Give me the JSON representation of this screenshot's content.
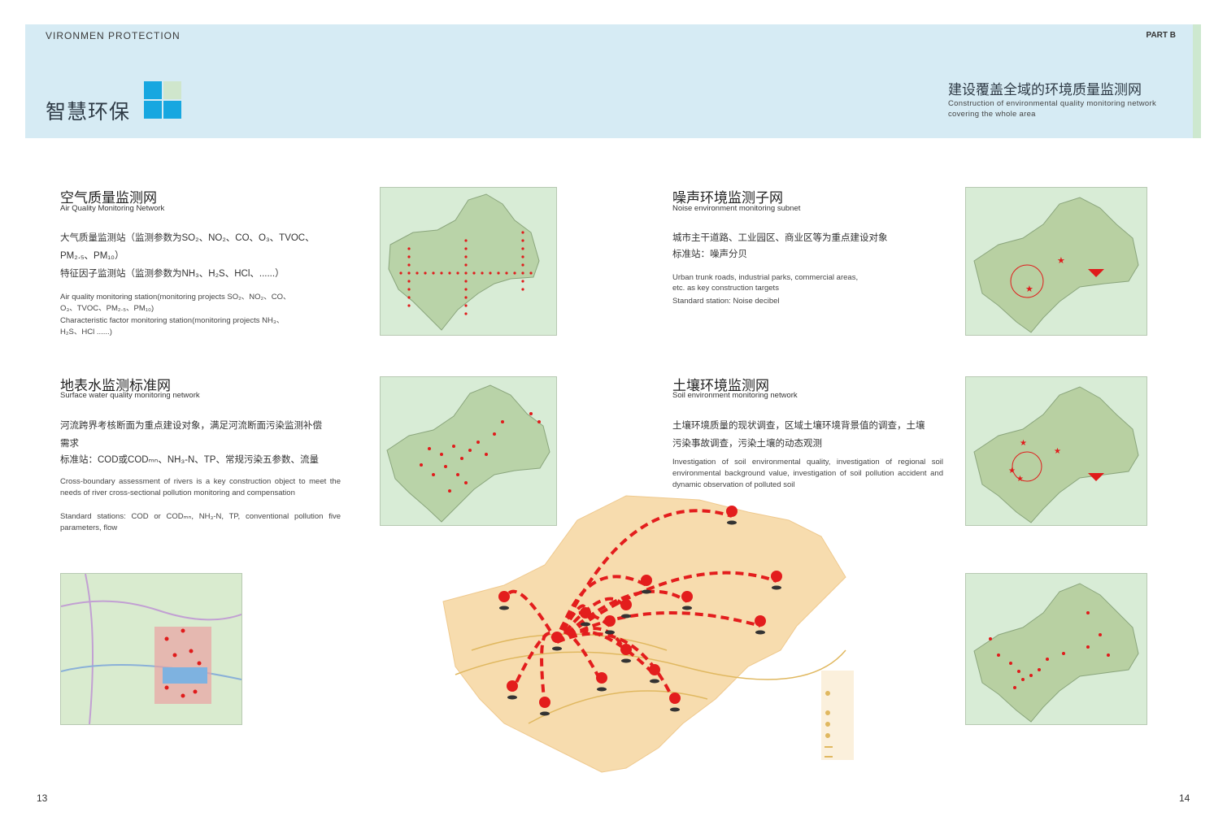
{
  "header": {
    "top_label": "VIRONMEN PROTECTION",
    "part": "PART B",
    "brand": "智慧环保",
    "title": "建设覆盖全域的环境质量监测网",
    "subtitle": "Construction of environmental quality monitoring network covering the whole area"
  },
  "sections": {
    "air": {
      "title": "空气质量监测网",
      "title_en": "Air Quality Monitoring Network",
      "cn_line1": "大气质量监测站（监测参数为SO₂、NO₂、CO、O₃、TVOC、",
      "cn_line2": "PM₂.₅、PM₁₀）",
      "cn_line3": "特征因子监测站（监测参数为NH₃、H₂S、HCl、......）",
      "en_line1": "Air quality monitoring station(monitoring projects SO₂、NO₂、CO、",
      "en_line2": "O₃、TVOC、PM₂.₅、PM₁₀)",
      "en_line3": "Characteristic factor monitoring station(monitoring projects NH₃、",
      "en_line4": "H₂S、HCl ......)"
    },
    "noise": {
      "title": "噪声环境监测子网",
      "title_en": "Noise environment monitoring subnet",
      "cn_line1": "城市主干道路、工业园区、商业区等为重点建设对象",
      "cn_line2": "标准站：噪声分贝",
      "en_line1": "Urban trunk roads, industrial parks, commercial areas,",
      "en_line2": "etc. as key  construction targets",
      "en_line3": "Standard station: Noise decibel"
    },
    "water": {
      "title": "地表水监测标准网",
      "title_en": "Surface water quality monitoring network",
      "cn_line1": "河流跨界考核断面为重点建设对象，满足河流断面污染监测补偿",
      "cn_line2": "需求",
      "cn_line3": "标准站：COD或CODₘₙ、NH₃-N、TP、常规污染五参数、流量",
      "en_line1": "Cross-boundary assessment of rivers is a key construction object to meet the needs of river cross-sectional pollution  monitoring and compensation",
      "en_line2": "Standard stations: COD or CODₘₙ, NH₃-N, TP, conventional pollution five parameters, flow"
    },
    "soil": {
      "title": "土壤环境监测网",
      "title_en": "Soil environment monitoring network",
      "cn_line1": "土壤环境质量的现状调查，区域土壤环境背景值的调查，土壤",
      "cn_line2": "污染事故调查，污染土壤的动态观测",
      "en_line1": "Investigation of soil environmental quality, investigation of regional soil environmental background value, investigation of soil pollution accident and dynamic observation of polluted soil"
    }
  },
  "page_numbers": {
    "left": "13",
    "right": "14"
  },
  "colors": {
    "header_bg": "#d6ebf4",
    "logo_blue": "#17a7e0",
    "map_green": "#cfe6cc",
    "marker_red": "#e01b1b",
    "route_red": "#e31d1d",
    "network_bg": "#f7dcae"
  }
}
